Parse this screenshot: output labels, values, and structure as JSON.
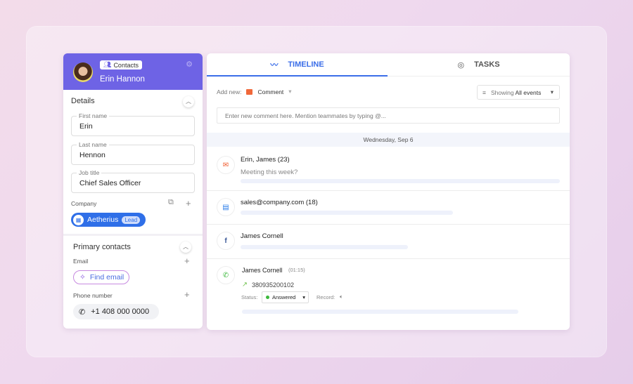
{
  "contact": {
    "badge": "Contacts",
    "name": "Erin Hannon"
  },
  "details": {
    "title": "Details",
    "fields": [
      {
        "label": "First name",
        "value": "Erin"
      },
      {
        "label": "Last name",
        "value": "Hennon"
      },
      {
        "label": "Job title",
        "value": "Chief Sales Officer"
      }
    ],
    "company_label": "Company",
    "company": "Aetherius",
    "company_tag": "Lead"
  },
  "primary": {
    "title": "Primary contacts",
    "email_label": "Email",
    "find_email": "Find email",
    "phone_label": "Phone number",
    "phone": "+1 408 000 0000"
  },
  "tabs": [
    {
      "label": "TIMELINE",
      "active": true
    },
    {
      "label": "TASKS",
      "active": false
    }
  ],
  "toolbar": {
    "add_new": "Add new:",
    "type": "Comment",
    "filter_prefix": "Showing",
    "filter_value": "All events"
  },
  "comment_placeholder": "Enter new comment here. Mention teammates by typing @...",
  "date": "Wednesday, Sep 6",
  "events": [
    {
      "icon": "email-icon",
      "title": "Erin, James (23)",
      "subtitle": "Meeting this week?"
    },
    {
      "icon": "intercom-icon",
      "title": "sales@company.com (18)"
    },
    {
      "icon": "facebook-icon",
      "title": "James Cornell"
    },
    {
      "icon": "call-icon",
      "title": "James Cornell",
      "duration": "(01:15)",
      "number": "380935200102",
      "status_label": "Status:",
      "status": "Answered",
      "record_label": "Record:"
    }
  ],
  "colors": {
    "header": "#6e63e5",
    "accent": "#3b6ee8",
    "company": "#2f6fe8",
    "status_ok": "#3cb83c"
  }
}
